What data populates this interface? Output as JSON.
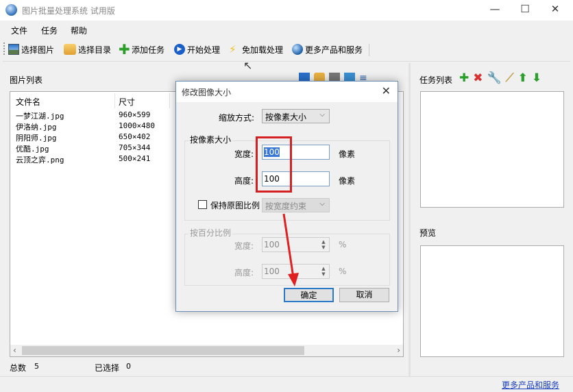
{
  "window": {
    "title": "图片批量处理系统 试用版",
    "minimize": "—",
    "maximize": "☐",
    "close": "✕"
  },
  "menu": [
    "文件",
    "任务",
    "帮助"
  ],
  "toolbar": [
    {
      "label": "选择图片",
      "icon": "image-icon"
    },
    {
      "label": "选择目录",
      "icon": "folder-icon"
    },
    {
      "label": "添加任务",
      "icon": "plus-icon"
    },
    {
      "label": "开始处理",
      "icon": "play-icon"
    },
    {
      "label": "免加载处理",
      "icon": "lightning-icon"
    },
    {
      "label": "更多产品和服务",
      "icon": "globe-icon"
    }
  ],
  "image_list": {
    "label": "图片列表",
    "columns": [
      "文件名",
      "尺寸"
    ],
    "rows": [
      {
        "name": "一梦江湖.jpg",
        "size": "960×599"
      },
      {
        "name": "伊洛纳.jpg",
        "size": "1000×480"
      },
      {
        "name": "阴阳师.jpg",
        "size": "650×402"
      },
      {
        "name": "优酷.jpg",
        "size": "705×344"
      },
      {
        "name": "云顶之弈.png",
        "size": "500×241"
      }
    ]
  },
  "status": {
    "total_label": "总数",
    "total": "5",
    "selected_label": "已选择",
    "selected": "0"
  },
  "task_list": {
    "label": "任务列表"
  },
  "preview": {
    "label": "预览"
  },
  "footer_link": "更多产品和服务",
  "dialog": {
    "title": "修改图像大小",
    "close": "✕",
    "scale_mode_label": "缩放方式:",
    "scale_mode": "按像素大小",
    "pixel_group": "按像素大小",
    "width_label": "宽度:",
    "width": "100",
    "height_label": "高度:",
    "height": "100",
    "unit": "像素",
    "keep_ratio_label": "保持原图比例",
    "keep_ratio_mode": "按宽度约束",
    "percent_group": "按百分比例",
    "pwidth_label": "宽度:",
    "pwidth": "100",
    "pheight_label": "高度:",
    "pheight": "100",
    "punit": "%",
    "ok": "确定",
    "cancel": "取消"
  }
}
